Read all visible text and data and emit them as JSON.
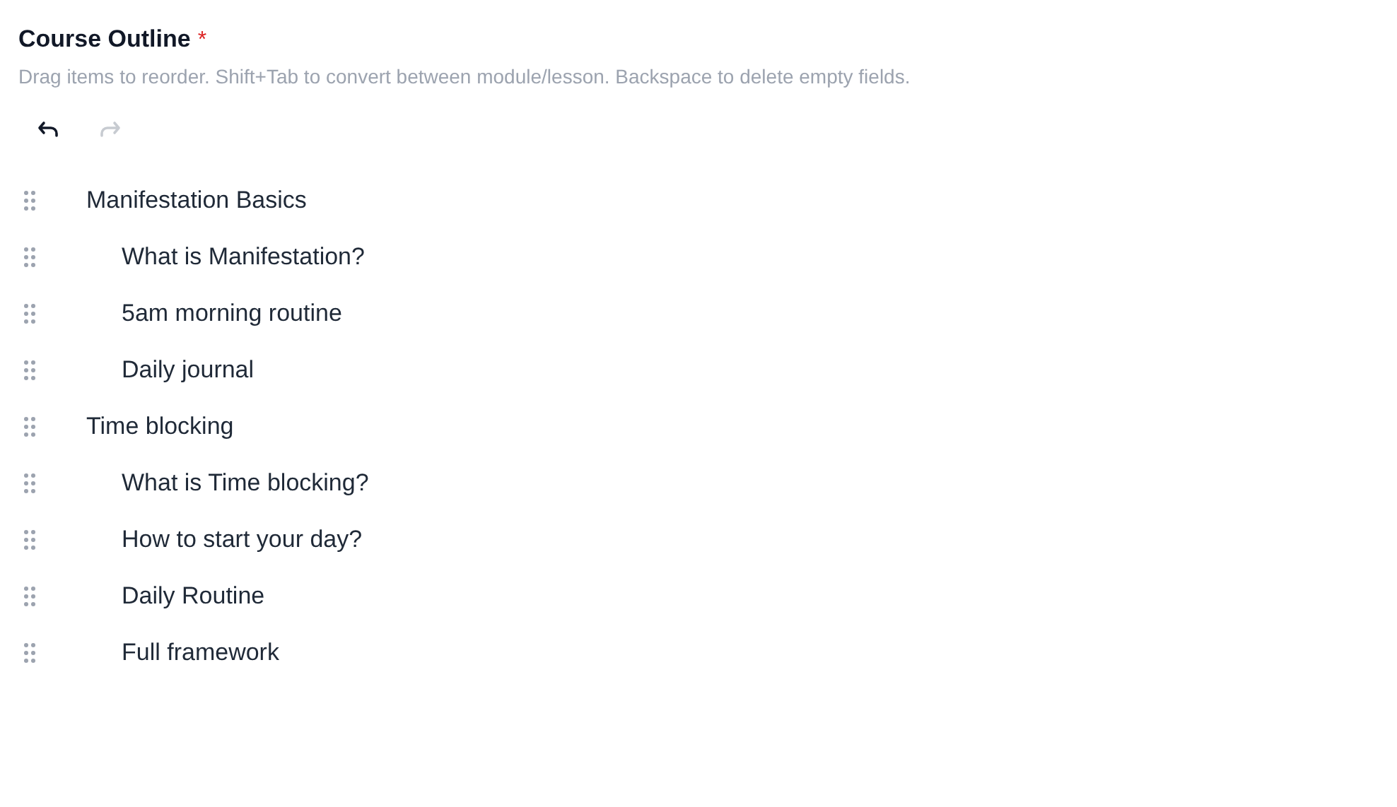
{
  "field": {
    "label": "Course Outline",
    "required_mark": "*",
    "hint": "Drag items to reorder. Shift+Tab to convert between module/lesson. Backspace to delete empty fields."
  },
  "history": [
    {
      "kind": "undo",
      "disabled": false
    },
    {
      "kind": "redo",
      "disabled": true
    }
  ],
  "outline": [
    {
      "title": "Manifestation Basics",
      "children": [
        {
          "title": "What is Manifestation?"
        },
        {
          "title": "5am morning routine"
        },
        {
          "title": "Daily journal"
        }
      ]
    },
    {
      "title": "Time blocking",
      "children": [
        {
          "title": "What is Time blocking?"
        },
        {
          "title": "How to start your day?"
        },
        {
          "title": "Daily Routine"
        },
        {
          "title": "Full framework"
        }
      ]
    }
  ]
}
